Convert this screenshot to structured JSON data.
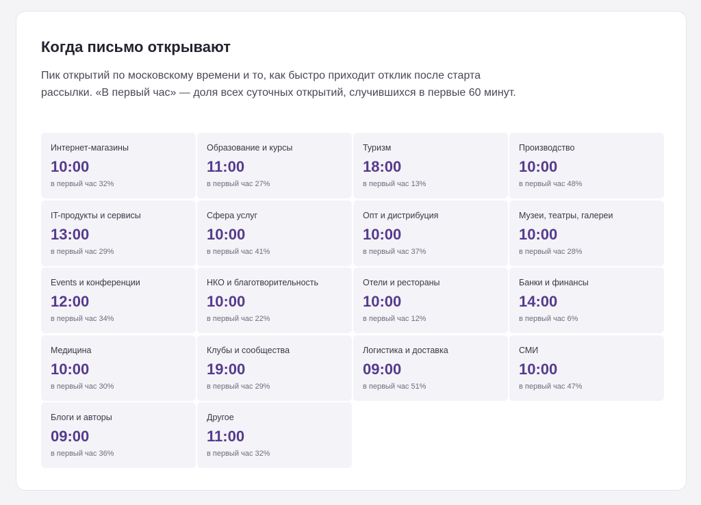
{
  "section": {
    "title": "Когда письмо открывают",
    "description": "Пик открытий по московскому времени и то, как быстро приходит отклик после старта рассылки. «В первый час» — доля всех суточных открытий, случившихся в первые 60 минут."
  },
  "industries": [
    {
      "name": "Интернет-магазины",
      "peak_time": "10:00",
      "first_hour": "в первый час 32%"
    },
    {
      "name": "Образование и курсы",
      "peak_time": "11:00",
      "first_hour": "в первый час 27%"
    },
    {
      "name": "Туризм",
      "peak_time": "18:00",
      "first_hour": "в первый час 13%"
    },
    {
      "name": "Производство",
      "peak_time": "10:00",
      "first_hour": "в первый час 48%"
    },
    {
      "name": "IT-продукты и сервисы",
      "peak_time": "13:00",
      "first_hour": "в первый час 29%"
    },
    {
      "name": "Сфера услуг",
      "peak_time": "10:00",
      "first_hour": "в первый час 41%"
    },
    {
      "name": "Опт и дистрибуция",
      "peak_time": "10:00",
      "first_hour": "в первый час 37%"
    },
    {
      "name": "Музеи, театры, галереи",
      "peak_time": "10:00",
      "first_hour": "в первый час 28%"
    },
    {
      "name": "Events и конференции",
      "peak_time": "12:00",
      "first_hour": "в первый час 34%"
    },
    {
      "name": "НКО и благотворительность",
      "peak_time": "10:00",
      "first_hour": "в первый час 22%"
    },
    {
      "name": "Отели и рестораны",
      "peak_time": "10:00",
      "first_hour": "в первый час 12%"
    },
    {
      "name": "Банки и финансы",
      "peak_time": "14:00",
      "first_hour": "в первый час 6%"
    },
    {
      "name": "Медицина",
      "peak_time": "10:00",
      "first_hour": "в первый час 30%"
    },
    {
      "name": "Клубы и сообщества",
      "peak_time": "19:00",
      "first_hour": "в первый час 29%"
    },
    {
      "name": "Логистика и доставка",
      "peak_time": "09:00",
      "first_hour": "в первый час 51%"
    },
    {
      "name": "СМИ",
      "peak_time": "10:00",
      "first_hour": "в первый час 47%"
    },
    {
      "name": "Блоги и авторы",
      "peak_time": "09:00",
      "first_hour": "в первый час 36%"
    },
    {
      "name": "Другое",
      "peak_time": "11:00",
      "first_hour": "в первый час 32%"
    }
  ],
  "colors": {
    "accent": "#553a8c",
    "cell_background": "#f4f3f8",
    "page_background": "#f4f4f7"
  }
}
